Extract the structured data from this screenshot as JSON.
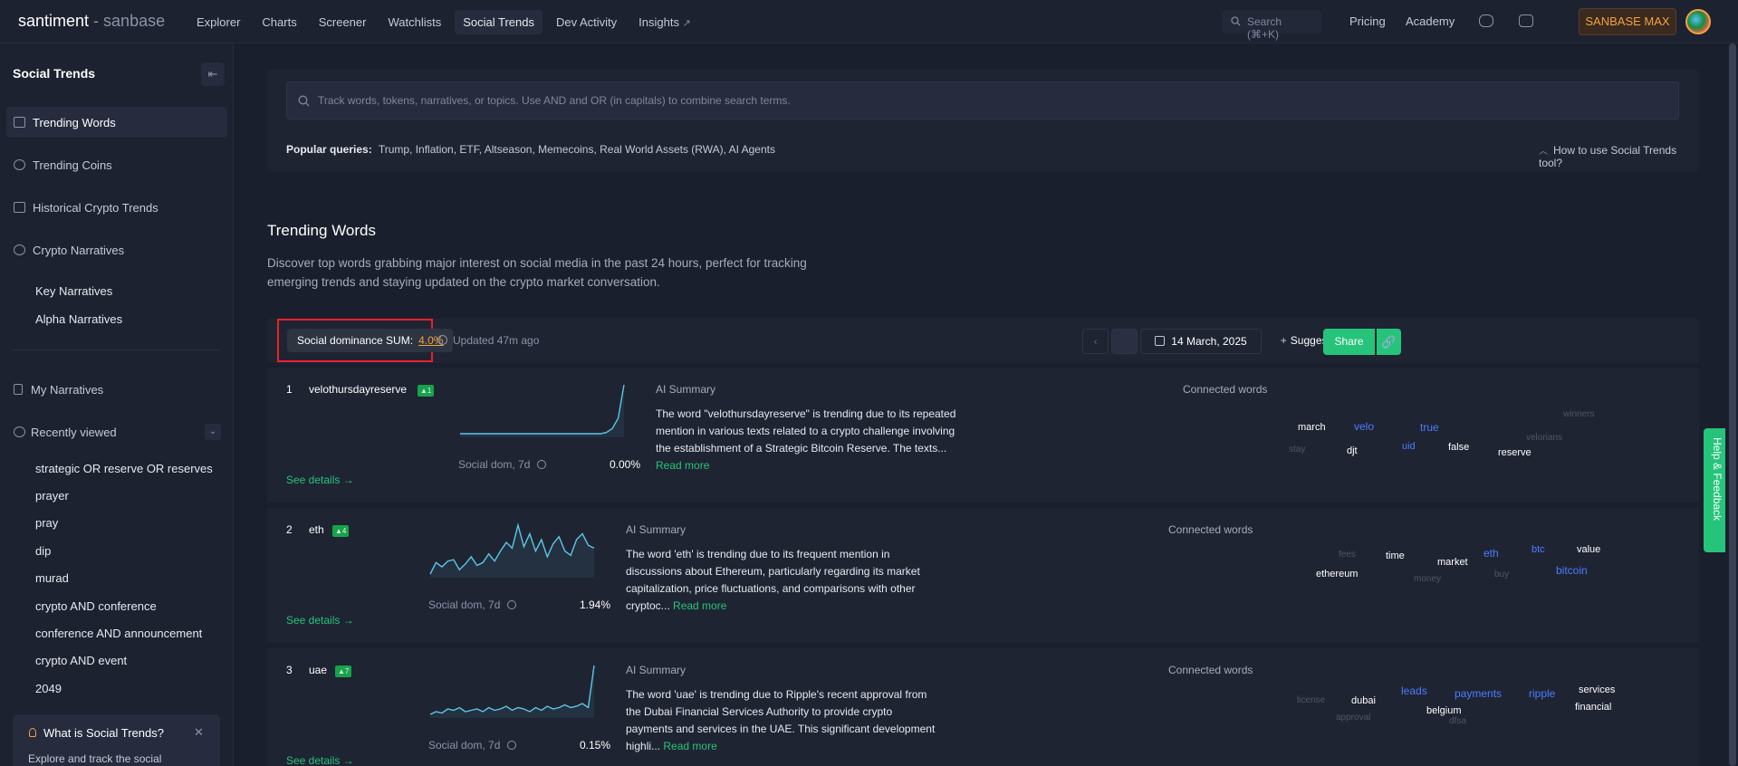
{
  "brand": {
    "name": "santiment",
    "sub": " - sanbase"
  },
  "nav": [
    "Explorer",
    "Charts",
    "Screener",
    "Watchlists",
    "Social Trends",
    "Dev Activity",
    "Insights"
  ],
  "search_label": "Search (⌘+K)",
  "top_links": {
    "pricing": "Pricing",
    "academy": "Academy",
    "max": "SANBASE MAX"
  },
  "sidebar": {
    "title": "Social Trends",
    "items": [
      "Trending Words",
      "Trending Coins",
      "Historical Crypto Trends",
      "Crypto Narratives"
    ],
    "narratives": [
      "Key Narratives",
      "Alpha Narratives"
    ],
    "my_narratives": "My Narratives",
    "recently_viewed": "Recently viewed",
    "recent": [
      "strategic OR reserve OR reserves",
      "prayer",
      "pray",
      "dip",
      "murad",
      "crypto AND conference",
      "conference AND announcement",
      "crypto AND event",
      "2049"
    ],
    "whatis_title": "What is Social Trends?",
    "whatis_desc": "Explore and track the social"
  },
  "search": {
    "placeholder": "Track words, tokens, narratives, or topics. Use AND and OR (in capitals) to combine search terms.",
    "popular_label": "Popular queries:",
    "popular": "Trump, Inflation, ETF, Altseason, Memecoins, Real World Assets (RWA), AI Agents",
    "howto": "How to use Social Trends tool?"
  },
  "trending": {
    "title": "Trending Words",
    "desc": "Discover top words grabbing major interest on social media in the past 24 hours, perfect for tracking emerging trends and staying updated on the crypto market conversation."
  },
  "toolbar": {
    "dominance_label": "Social dominance SUM:",
    "dominance_value": "4.0%",
    "updated": "Updated 47m ago",
    "date": "14 March, 2025",
    "suggest": "Suggest account",
    "share": "Share"
  },
  "labels": {
    "see_details": "See details",
    "social_dom": "Social dom, 7d",
    "ai_summary": "AI Summary",
    "connected": "Connected words",
    "read_more": "Read more"
  },
  "rows": [
    {
      "rank": "1",
      "word": "velothursdayreserve",
      "change": "1",
      "dom": "0.00%",
      "summary": "The word \"velothursdayreserve\" is trending due to its repeated mention in various texts related to a crypto challenge involving the establishment of a Strategic Bitcoin Reserve. The texts...",
      "spark": [
        2,
        2,
        2,
        2,
        2,
        2,
        2,
        2,
        2,
        2,
        2,
        2,
        2,
        2,
        2,
        2,
        2,
        2,
        2,
        2,
        2,
        2,
        2,
        2,
        2,
        3,
        6,
        14,
        40
      ],
      "connected": [
        "winners",
        "march",
        "velo",
        "true",
        "velorians",
        "stay",
        "djt",
        "uid",
        "false",
        "reserve"
      ]
    },
    {
      "rank": "2",
      "word": "eth",
      "change": "4",
      "dom": "1.94%",
      "summary": "The word 'eth' is trending due to its frequent mention in discussions about Ethereum, particularly regarding its market capitalization, price fluctuations, and comparisons with other cryptoc...",
      "spark": [
        6,
        14,
        11,
        15,
        16,
        9,
        13,
        18,
        12,
        14,
        20,
        15,
        22,
        28,
        24,
        40,
        25,
        34,
        22,
        30,
        18,
        27,
        32,
        22,
        19,
        30,
        34,
        26,
        24
      ],
      "connected": [
        "fees",
        "time",
        "market",
        "eth",
        "btc",
        "value",
        "ethereum",
        "money",
        "buy",
        "bitcoin"
      ]
    },
    {
      "rank": "3",
      "word": "uae",
      "change": "7",
      "dom": "0.15%",
      "summary": "The word 'uae' is trending due to Ripple's recent approval from the Dubai Financial Services Authority to provide crypto payments and services in the UAE. This significant development highli...",
      "spark": [
        4,
        6,
        5,
        8,
        7,
        9,
        6,
        7,
        8,
        6,
        9,
        7,
        8,
        10,
        7,
        9,
        8,
        6,
        9,
        7,
        10,
        8,
        9,
        11,
        9,
        10,
        12,
        9,
        40
      ],
      "connected": [
        "license",
        "dubai",
        "leads",
        "payments",
        "ripple",
        "services",
        "belgium",
        "financial",
        "approval",
        "dfsa"
      ]
    }
  ],
  "help": "Help & Feedback",
  "colors": {
    "accent_green": "#26c47a",
    "accent_orange": "#f5a142",
    "link_blue": "#4c7dff"
  }
}
